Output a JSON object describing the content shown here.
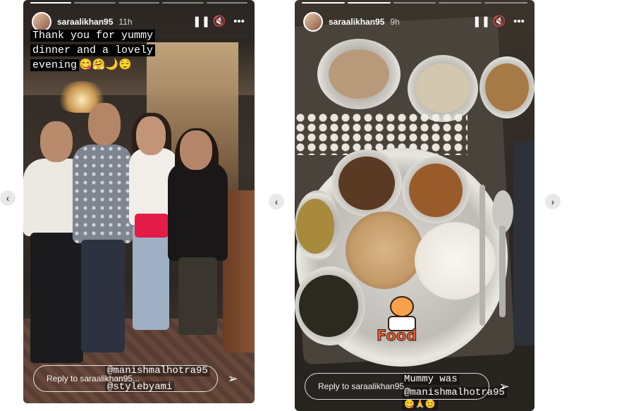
{
  "stories": [
    {
      "username": "saraalikhan95",
      "time_ago": "11h",
      "caption_lines": [
        "Thank you for yummy",
        "dinner and a lovely",
        "evening"
      ],
      "caption_emojis": "😋🤗🌙😌",
      "mentions": [
        "@manishmalhotra95",
        "@stylebyami"
      ],
      "reply_placeholder": "Reply to saraalikhan95...",
      "progress": {
        "segments": 5,
        "active": 1
      }
    },
    {
      "username": "saraalikhan95",
      "time_ago": "9h",
      "sticker_text": "Food",
      "caption_lines": [
        "Mummy was",
        "@manishmalhotra95"
      ],
      "caption_emojis": "😋🙏😊",
      "reply_placeholder": "Reply to saraalikhan95...",
      "progress": {
        "segments": 5,
        "active": 2
      }
    }
  ],
  "icons": {
    "pause": "pause-icon",
    "mute": "mute-icon",
    "more": "more-options-icon",
    "send": "send-icon",
    "prev": "chevron-left-icon",
    "next": "chevron-right-icon"
  },
  "colors": {
    "background": "#ffffff",
    "bag_accent": "#e31d48",
    "arrow_bg": "#e9e9e9"
  }
}
